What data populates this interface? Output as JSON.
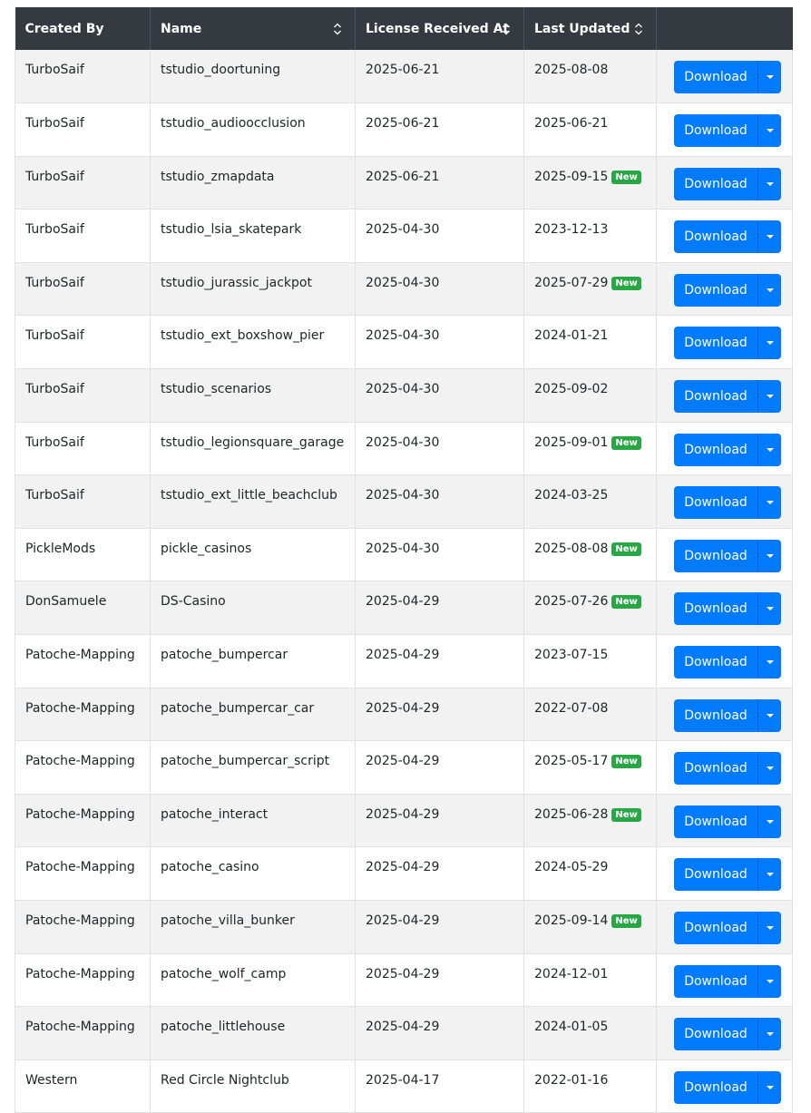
{
  "table": {
    "headers": {
      "created_by": "Created By",
      "name": "Name",
      "license_received_at": "License Received At",
      "last_updated": "Last Updated",
      "actions": ""
    },
    "download_label": "Download",
    "new_badge_label": "New",
    "rows": [
      {
        "created_by": "TurboSaif",
        "name": "tstudio_doortuning",
        "license_received_at": "2025-06-21",
        "last_updated": "2025-08-08",
        "is_new": false
      },
      {
        "created_by": "TurboSaif",
        "name": "tstudio_audioocclusion",
        "license_received_at": "2025-06-21",
        "last_updated": "2025-06-21",
        "is_new": false
      },
      {
        "created_by": "TurboSaif",
        "name": "tstudio_zmapdata",
        "license_received_at": "2025-06-21",
        "last_updated": "2025-09-15",
        "is_new": true
      },
      {
        "created_by": "TurboSaif",
        "name": "tstudio_lsia_skatepark",
        "license_received_at": "2025-04-30",
        "last_updated": "2023-12-13",
        "is_new": false
      },
      {
        "created_by": "TurboSaif",
        "name": "tstudio_jurassic_jackpot",
        "license_received_at": "2025-04-30",
        "last_updated": "2025-07-29",
        "is_new": true
      },
      {
        "created_by": "TurboSaif",
        "name": "tstudio_ext_boxshow_pier",
        "license_received_at": "2025-04-30",
        "last_updated": "2024-01-21",
        "is_new": false
      },
      {
        "created_by": "TurboSaif",
        "name": "tstudio_scenarios",
        "license_received_at": "2025-04-30",
        "last_updated": "2025-09-02",
        "is_new": false
      },
      {
        "created_by": "TurboSaif",
        "name": "tstudio_legionsquare_garage",
        "license_received_at": "2025-04-30",
        "last_updated": "2025-09-01",
        "is_new": true
      },
      {
        "created_by": "TurboSaif",
        "name": "tstudio_ext_little_beachclub",
        "license_received_at": "2025-04-30",
        "last_updated": "2024-03-25",
        "is_new": false
      },
      {
        "created_by": "PickleMods",
        "name": "pickle_casinos",
        "license_received_at": "2025-04-30",
        "last_updated": "2025-08-08",
        "is_new": true
      },
      {
        "created_by": "DonSamuele",
        "name": "DS-Casino",
        "license_received_at": "2025-04-29",
        "last_updated": "2025-07-26",
        "is_new": true
      },
      {
        "created_by": "Patoche-Mapping",
        "name": "patoche_bumpercar",
        "license_received_at": "2025-04-29",
        "last_updated": "2023-07-15",
        "is_new": false
      },
      {
        "created_by": "Patoche-Mapping",
        "name": "patoche_bumpercar_car",
        "license_received_at": "2025-04-29",
        "last_updated": "2022-07-08",
        "is_new": false
      },
      {
        "created_by": "Patoche-Mapping",
        "name": "patoche_bumpercar_script",
        "license_received_at": "2025-04-29",
        "last_updated": "2025-05-17",
        "is_new": true
      },
      {
        "created_by": "Patoche-Mapping",
        "name": "patoche_interact",
        "license_received_at": "2025-04-29",
        "last_updated": "2025-06-28",
        "is_new": true
      },
      {
        "created_by": "Patoche-Mapping",
        "name": "patoche_casino",
        "license_received_at": "2025-04-29",
        "last_updated": "2024-05-29",
        "is_new": false
      },
      {
        "created_by": "Patoche-Mapping",
        "name": "patoche_villa_bunker",
        "license_received_at": "2025-04-29",
        "last_updated": "2025-09-14",
        "is_new": true
      },
      {
        "created_by": "Patoche-Mapping",
        "name": "patoche_wolf_camp",
        "license_received_at": "2025-04-29",
        "last_updated": "2024-12-01",
        "is_new": false
      },
      {
        "created_by": "Patoche-Mapping",
        "name": "patoche_littlehouse",
        "license_received_at": "2025-04-29",
        "last_updated": "2024-01-05",
        "is_new": false
      },
      {
        "created_by": "Western",
        "name": "Red Circle Nightclub",
        "license_received_at": "2025-04-17",
        "last_updated": "2022-01-16",
        "is_new": false
      }
    ]
  },
  "colors": {
    "header_bg": "#343a40",
    "button_primary": "#007bff",
    "badge_success": "#28a745",
    "row_striped": "#f2f2f2"
  },
  "icons": {
    "sort": "sort-icon",
    "caret": "caret-down-icon"
  }
}
